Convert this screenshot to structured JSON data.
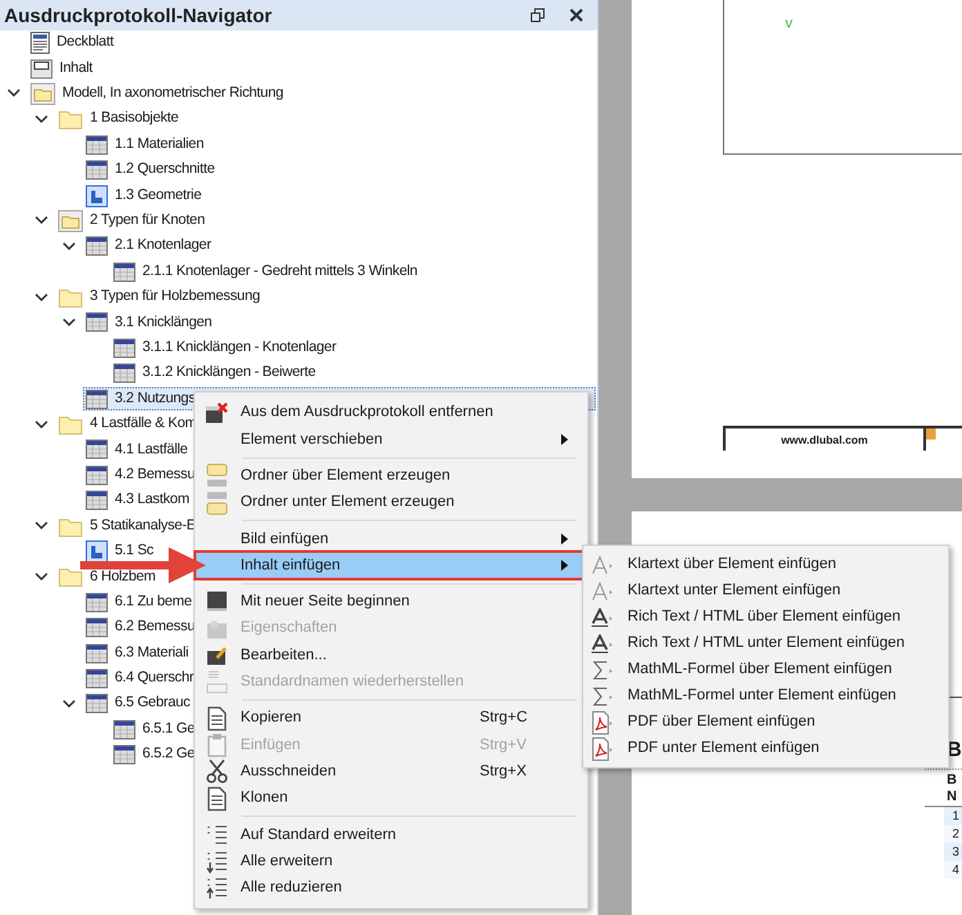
{
  "panel": {
    "title": "Ausdruckprotokoll-Navigator",
    "tree": [
      {
        "label": "Deckblatt",
        "kind": "page",
        "selected": false
      },
      {
        "label": "Inhalt",
        "kind": "toc",
        "selected": false
      },
      {
        "label": "Modell, In axonometrischer Richtung",
        "kind": "model",
        "selected": false,
        "expanded": true,
        "children": [
          {
            "label": "1 Basisobjekte",
            "kind": "folder",
            "selected": false,
            "expanded": true,
            "children": [
              {
                "label": "1.1 Materialien",
                "kind": "table",
                "selected": false
              },
              {
                "label": "1.2 Querschnitte",
                "kind": "table",
                "selected": false
              },
              {
                "label": "1.3 Geometrie",
                "kind": "image",
                "selected": false
              }
            ]
          },
          {
            "label": "2 Typen für Knoten",
            "kind": "model",
            "selected": false,
            "expanded": true,
            "children": [
              {
                "label": "2.1 Knotenlager",
                "kind": "table",
                "selected": false,
                "expanded": true,
                "children": [
                  {
                    "label": "2.1.1 Knotenlager - Gedreht mittels 3 Winkeln",
                    "kind": "table",
                    "selected": false
                  }
                ]
              }
            ]
          },
          {
            "label": "3 Typen für Holzbemessung",
            "kind": "folder",
            "selected": false,
            "expanded": true,
            "children": [
              {
                "label": "3.1 Knicklängen",
                "kind": "table",
                "selected": false,
                "expanded": true,
                "children": [
                  {
                    "label": "3.1.1 Knicklängen - Knotenlager",
                    "kind": "table",
                    "selected": false
                  },
                  {
                    "label": "3.1.2 Knicklängen - Beiwerte",
                    "kind": "table",
                    "selected": false
                  }
                ]
              },
              {
                "label": "3.2 Nutzungs",
                "kind": "table",
                "selected": true
              }
            ]
          },
          {
            "label": "4 Lastfälle & Kom",
            "kind": "folder",
            "selected": false,
            "expanded": true,
            "children": [
              {
                "label": "4.1 Lastfälle",
                "kind": "table",
                "selected": false
              },
              {
                "label": "4.2 Bemessu",
                "kind": "table",
                "selected": false
              },
              {
                "label": "4.3 Lastkom",
                "kind": "table",
                "selected": false
              }
            ]
          },
          {
            "label": "5 Statikanalyse-E",
            "kind": "folder",
            "selected": false,
            "expanded": true,
            "children": [
              {
                "label": "5.1 Sc",
                "kind": "image",
                "selected": false
              }
            ]
          },
          {
            "label": "6 Holzbem",
            "kind": "folder",
            "selected": false,
            "expanded": true,
            "children": [
              {
                "label": "6.1 Zu beme",
                "kind": "table",
                "selected": false
              },
              {
                "label": "6.2 Bemessu",
                "kind": "table",
                "selected": false
              },
              {
                "label": "6.3 Materiali",
                "kind": "table",
                "selected": false
              },
              {
                "label": "6.4 Querschr",
                "kind": "table",
                "selected": false
              },
              {
                "label": "6.5 Gebrauc",
                "kind": "table",
                "selected": false,
                "expanded": true,
                "children": [
                  {
                    "label": "6.5.1 Ge",
                    "kind": "table",
                    "selected": false
                  },
                  {
                    "label": "6.5.2 Ge",
                    "kind": "table",
                    "selected": false
                  }
                ]
              }
            ]
          }
        ]
      }
    ]
  },
  "context_menu": {
    "items": [
      {
        "kind": "remove",
        "label": "Aus dem Ausdruckprotokoll entfernen",
        "disabled": false,
        "selected": false,
        "submenu": false
      },
      {
        "kind": "plain",
        "label": "Element verschieben",
        "disabled": false,
        "selected": false,
        "submenu": true
      },
      {
        "kind": "separator"
      },
      {
        "kind": "folder-above",
        "label": "Ordner über Element erzeugen",
        "disabled": false,
        "selected": false,
        "submenu": false
      },
      {
        "kind": "folder-below",
        "label": "Ordner unter Element erzeugen",
        "disabled": false,
        "selected": false,
        "submenu": false
      },
      {
        "kind": "separator"
      },
      {
        "kind": "plain",
        "label": "Bild einfügen",
        "disabled": false,
        "selected": false,
        "submenu": true
      },
      {
        "kind": "plain",
        "label": "Inhalt einfügen",
        "disabled": false,
        "selected": true,
        "submenu": true,
        "callout": true
      },
      {
        "kind": "separator"
      },
      {
        "kind": "page-break",
        "label": "Mit neuer Seite beginnen",
        "disabled": false,
        "selected": false,
        "submenu": false
      },
      {
        "kind": "properties",
        "label": "Eigenschaften",
        "disabled": true,
        "selected": false,
        "submenu": false
      },
      {
        "kind": "edit",
        "label": "Bearbeiten...",
        "disabled": false,
        "selected": false,
        "submenu": false
      },
      {
        "kind": "rename",
        "label": "Standardnamen wiederherstellen",
        "disabled": true,
        "selected": false,
        "submenu": false
      },
      {
        "kind": "separator"
      },
      {
        "kind": "copy",
        "label": "Kopieren",
        "shortcut": "Strg+C",
        "disabled": false,
        "selected": false,
        "submenu": false
      },
      {
        "kind": "paste",
        "label": "Einfügen",
        "shortcut": "Strg+V",
        "disabled": true,
        "selected": false,
        "submenu": false
      },
      {
        "kind": "cut",
        "label": "Ausschneiden",
        "shortcut": "Strg+X",
        "disabled": false,
        "selected": false,
        "submenu": false
      },
      {
        "kind": "clone",
        "label": "Klonen",
        "disabled": false,
        "selected": false,
        "submenu": false
      },
      {
        "kind": "separator"
      },
      {
        "kind": "expand-standard",
        "label": "Auf Standard erweitern",
        "disabled": false,
        "selected": false,
        "submenu": false
      },
      {
        "kind": "expand-all",
        "label": "Alle erweitern",
        "disabled": false,
        "selected": false,
        "submenu": false
      },
      {
        "kind": "collapse-all",
        "label": "Alle reduzieren",
        "disabled": false,
        "selected": false,
        "submenu": false
      }
    ]
  },
  "submenu": {
    "items": [
      {
        "label": "Klartext über Element einfügen",
        "kind": "text"
      },
      {
        "label": "Klartext unter Element einfügen",
        "kind": "text"
      },
      {
        "label": "Rich Text / HTML über Element einfügen",
        "kind": "rich-text"
      },
      {
        "label": "Rich Text / HTML unter Element einfügen",
        "kind": "rich-text"
      },
      {
        "label": "MathML-Formel über Element einfügen",
        "kind": "formula"
      },
      {
        "label": "MathML-Formel unter Element einfügen",
        "kind": "formula"
      },
      {
        "label": "PDF über Element einfügen",
        "kind": "pdf"
      },
      {
        "label": "PDF unter Element einfügen",
        "kind": "pdf"
      }
    ]
  },
  "preview": {
    "top_page": {
      "mark": "v",
      "footer": "www.dlubal.com"
    },
    "bottom_page": {
      "heading": "B",
      "table_header": [
        "B",
        "N"
      ],
      "row_numbers": [
        "1",
        "2",
        "3",
        "4"
      ]
    }
  }
}
